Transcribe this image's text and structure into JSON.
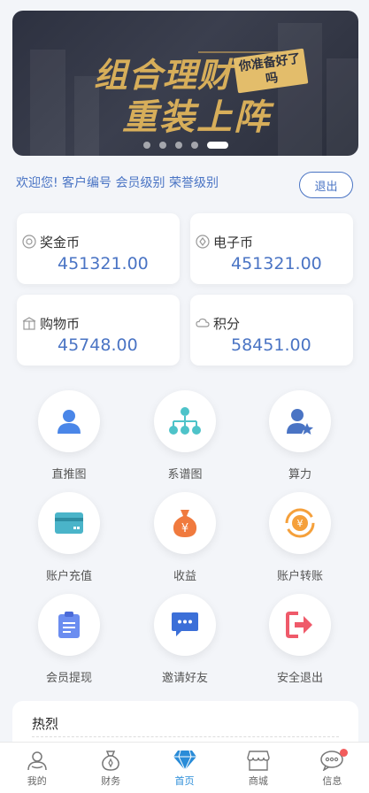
{
  "banner": {
    "title_line1": "组合理财",
    "title_line2": "重装上阵",
    "badge_text": "你准备好了吗",
    "dots": [
      false,
      false,
      false,
      false,
      true
    ]
  },
  "welcome": {
    "text": "欢迎您! 客户编号 会员级别 荣誉级别",
    "logout_label": "退出"
  },
  "balances": [
    {
      "label": "奖金币",
      "value": "451321.00",
      "icon": "target-icon"
    },
    {
      "label": "电子币",
      "value": "451321.00",
      "icon": "diamond-icon"
    },
    {
      "label": "购物币",
      "value": "45748.00",
      "icon": "gift-icon"
    },
    {
      "label": "积分",
      "value": "58451.00",
      "icon": "cloud-icon"
    }
  ],
  "menu": [
    {
      "label": "直推图",
      "icon": "person-icon"
    },
    {
      "label": "系谱图",
      "icon": "org-chart-icon"
    },
    {
      "label": "算力",
      "icon": "user-star-icon"
    },
    {
      "label": "账户充值",
      "icon": "card-icon"
    },
    {
      "label": "收益",
      "icon": "money-bag-icon"
    },
    {
      "label": "账户转账",
      "icon": "exchange-icon"
    },
    {
      "label": "会员提现",
      "icon": "clipboard-icon"
    },
    {
      "label": "邀请好友",
      "icon": "chat-icon"
    },
    {
      "label": "安全退出",
      "icon": "exit-icon"
    }
  ],
  "hot": {
    "title": "热烈"
  },
  "tabbar": [
    {
      "label": "我的",
      "icon": "profile-icon",
      "active": false
    },
    {
      "label": "财务",
      "icon": "finance-bag-icon",
      "active": false
    },
    {
      "label": "首页",
      "icon": "diamond-home-icon",
      "active": true
    },
    {
      "label": "商城",
      "icon": "store-icon",
      "active": false
    },
    {
      "label": "信息",
      "icon": "message-icon",
      "active": false,
      "badge": true
    }
  ],
  "colors": {
    "accent": "#4a74c4",
    "active_tab": "#2a8cd8",
    "badge": "#f25c5c",
    "gold": "#d7ae5a"
  }
}
